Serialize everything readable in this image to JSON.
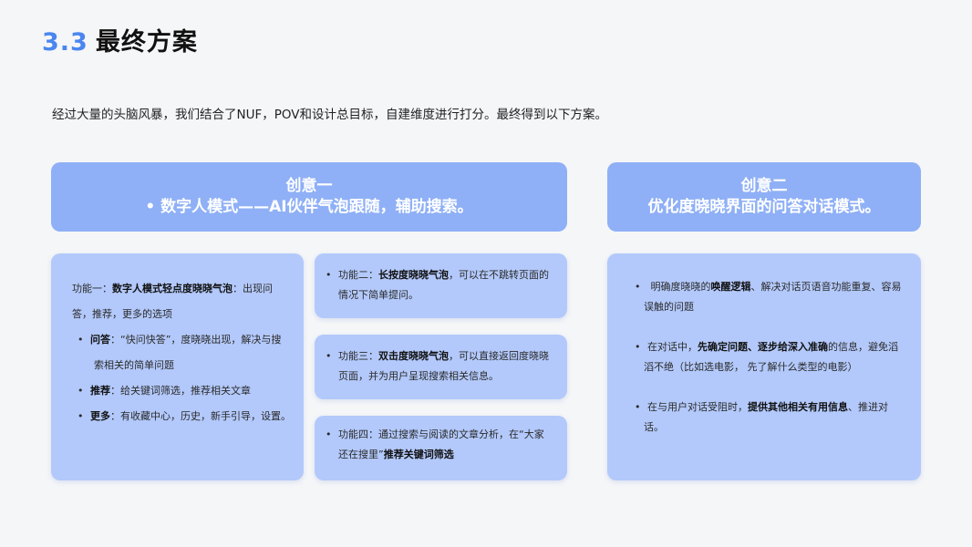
{
  "title": {
    "number": "3.3",
    "text": "最终方案"
  },
  "intro": "经过大量的头脑风暴，我们结合了NUF，POV和设计总目标，自建维度进行打分。最终得到以下方案。",
  "idea1": {
    "title": "创意一",
    "subtitle": "• 数字人模式——AI伙伴气泡跟随，辅助搜索。",
    "feature1": {
      "prefix": "功能一：",
      "bold": "数字人模式轻点度晓晓气泡",
      "suffix_line1": "：出现问",
      "line2": "答，推荐，更多的选项",
      "items": [
        {
          "label": "问答",
          "text_line1": "：“快问快答”，度晓晓出现，解决与搜",
          "text_line2": "索相关的简单问题"
        },
        {
          "label": "推荐",
          "text_line1": "：给关键词筛选，推荐相关文章",
          "text_line2": ""
        },
        {
          "label": "更多",
          "text_line1": "：有收藏中心，历史，新手引导，设置。",
          "text_line2": ""
        }
      ]
    },
    "feature2": {
      "prefix": "功能二：",
      "bold": "长按度晓晓气泡",
      "suffix_line1": "，可以在不跳转页面的",
      "line2": "情况下简单提问。"
    },
    "feature3": {
      "prefix": "功能三：",
      "bold": "双击度晓晓气泡",
      "suffix_line1": "，可以直接返回度晓晓",
      "line2": "页面，并为用户呈现搜索相关信息。"
    },
    "feature4": {
      "prefix": "功能四：通过搜索与阅读的文章分析，在“大家",
      "line2_prefix": "还在搜里”",
      "bold": "推荐关键词筛选"
    }
  },
  "idea2": {
    "title": "创意二",
    "subtitle": "优化度晓晓界面的问答对话模式。",
    "p1": {
      "prefix": " 明确度晓晓的",
      "bold": "唤醒逻辑",
      "suffix_line1": "、解决对话页语音功能重复、容易",
      "line2": "误触的问题"
    },
    "p2": {
      "prefix": "在对话中，",
      "bold": "先确定问题、逐步给深入准确",
      "suffix_line1": "的信息，避免滔",
      "line2": "滔不绝（比如选电影， 先了解什么类型的电影）"
    },
    "p3": {
      "prefix": "在与用户对话受阻时，",
      "bold": "提供其他相关有用信息",
      "suffix_line1": "、推进对",
      "line2": "话。"
    }
  },
  "bullet": "•",
  "colors": {
    "accent": "#4a86f0",
    "header_bg": "#8fb0f6",
    "card_bg": "#b3c9fb",
    "page_bg": "#f5f6f8"
  }
}
